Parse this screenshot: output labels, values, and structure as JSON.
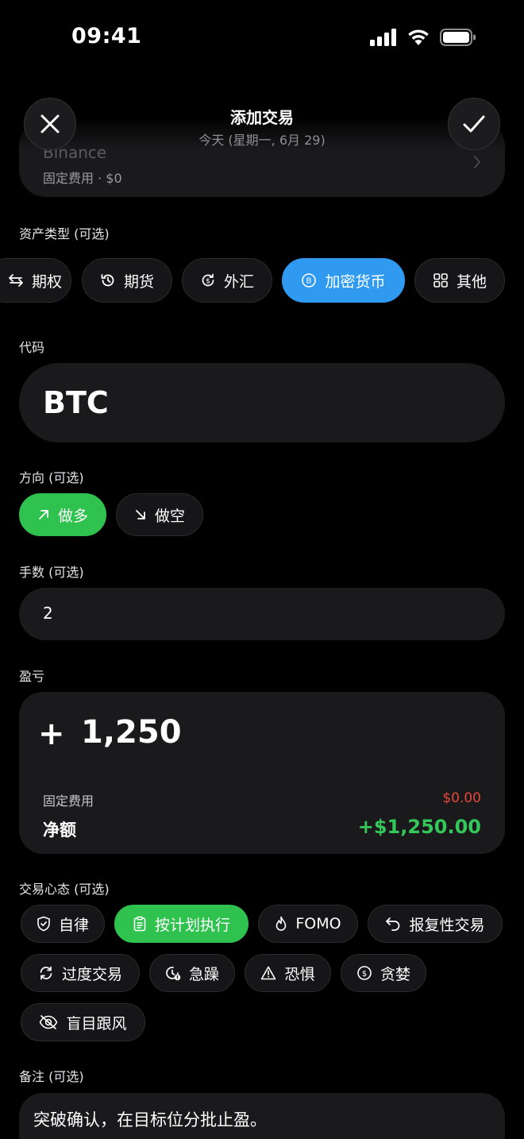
{
  "status_bar": {
    "time": "09:41"
  },
  "header": {
    "title": "添加交易",
    "subtitle": "今天 (星期一, 6月 29)"
  },
  "account": {
    "name": "Binance",
    "fee_text": "固定费用 · $0"
  },
  "asset_type": {
    "label": "资产类型 (可选)",
    "options": [
      "期权",
      "期货",
      "外汇",
      "加密货币",
      "其他"
    ],
    "selected": "加密货币",
    "accent_color": "#2f9af0"
  },
  "ticker": {
    "label": "代码",
    "value": "BTC"
  },
  "direction": {
    "label": "方向 (可选)",
    "long_label": "做多",
    "short_label": "做空",
    "selected": "做多",
    "accent_color": "#2fc24f"
  },
  "quantity": {
    "label": "手数 (可选)",
    "value": "2"
  },
  "pnl": {
    "label": "盈亏",
    "sign": "+",
    "value": "1,250",
    "fee_label": "固定费用",
    "fee_value": "$0.00",
    "net_label": "净额",
    "net_value": "+$1,250.00",
    "fee_color": "#e5483b",
    "net_color": "#34c759"
  },
  "emotion": {
    "label": "交易心态 (可选)",
    "options": [
      "自律",
      "按计划执行",
      "FOMO",
      "报复性交易",
      "过度交易",
      "急躁",
      "恐惧",
      "贪婪",
      "盲目跟风"
    ],
    "selected": "按计划执行"
  },
  "notes": {
    "label": "备注 (可选)",
    "value": "突破确认，在目标位分批止盈。"
  },
  "icons": {
    "close": "close-icon",
    "confirm": "checkmark-icon",
    "chevron": "chevron-right-icon"
  }
}
